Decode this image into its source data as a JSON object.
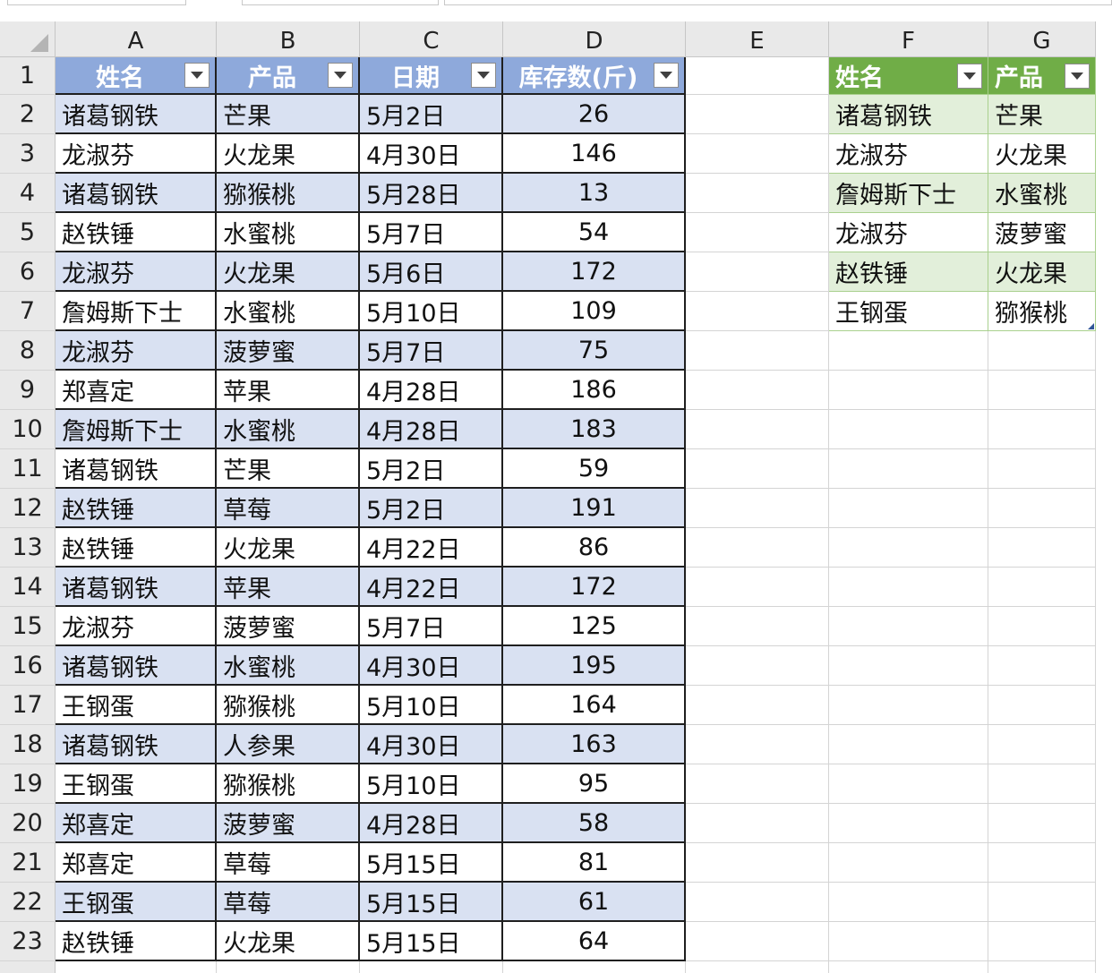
{
  "columns": [
    "A",
    "B",
    "C",
    "D",
    "E",
    "F",
    "G"
  ],
  "row_numbers": [
    "1",
    "2",
    "3",
    "4",
    "5",
    "6",
    "7",
    "8",
    "9",
    "10",
    "11",
    "12",
    "13",
    "14",
    "15",
    "16",
    "17",
    "18",
    "19",
    "20",
    "21",
    "22",
    "23"
  ],
  "table1": {
    "headers": [
      "姓名",
      "产品",
      "日期",
      "库存数(斤)"
    ],
    "rows": [
      [
        "诸葛钢铁",
        "芒果",
        "5月2日",
        "26"
      ],
      [
        "龙淑芬",
        "火龙果",
        "4月30日",
        "146"
      ],
      [
        "诸葛钢铁",
        "猕猴桃",
        "5月28日",
        "13"
      ],
      [
        "赵铁锤",
        "水蜜桃",
        "5月7日",
        "54"
      ],
      [
        "龙淑芬",
        "火龙果",
        "5月6日",
        "172"
      ],
      [
        "詹姆斯下士",
        "水蜜桃",
        "5月10日",
        "109"
      ],
      [
        "龙淑芬",
        "菠萝蜜",
        "5月7日",
        "75"
      ],
      [
        "郑喜定",
        "苹果",
        "4月28日",
        "186"
      ],
      [
        "詹姆斯下士",
        "水蜜桃",
        "4月28日",
        "183"
      ],
      [
        "诸葛钢铁",
        "芒果",
        "5月2日",
        "59"
      ],
      [
        "赵铁锤",
        "草莓",
        "5月2日",
        "191"
      ],
      [
        "赵铁锤",
        "火龙果",
        "4月22日",
        "86"
      ],
      [
        "诸葛钢铁",
        "苹果",
        "4月22日",
        "172"
      ],
      [
        "龙淑芬",
        "菠萝蜜",
        "5月7日",
        "125"
      ],
      [
        "诸葛钢铁",
        "水蜜桃",
        "4月30日",
        "195"
      ],
      [
        "王钢蛋",
        "猕猴桃",
        "5月10日",
        "164"
      ],
      [
        "诸葛钢铁",
        "人参果",
        "4月30日",
        "163"
      ],
      [
        "王钢蛋",
        "猕猴桃",
        "5月10日",
        "95"
      ],
      [
        "郑喜定",
        "菠萝蜜",
        "4月28日",
        "58"
      ],
      [
        "郑喜定",
        "草莓",
        "5月15日",
        "81"
      ],
      [
        "王钢蛋",
        "草莓",
        "5月15日",
        "61"
      ],
      [
        "赵铁锤",
        "火龙果",
        "5月15日",
        "64"
      ]
    ]
  },
  "table2": {
    "headers": [
      "姓名",
      "产品"
    ],
    "rows": [
      [
        "诸葛钢铁",
        "芒果"
      ],
      [
        "龙淑芬",
        "火龙果"
      ],
      [
        "詹姆斯下士",
        "水蜜桃"
      ],
      [
        "龙淑芬",
        "菠萝蜜"
      ],
      [
        "赵铁锤",
        "火龙果"
      ],
      [
        "王钢蛋",
        "猕猴桃"
      ]
    ]
  },
  "colors": {
    "table1_header": "#8ea9db",
    "table1_band": "#d9e1f2",
    "table2_header": "#70ad47",
    "table2_band": "#e2efda"
  },
  "icons": {
    "filter_button": "dropdown-arrow-icon",
    "select_all": "select-all-triangle-icon",
    "table_resize": "table-resize-handle-icon"
  }
}
